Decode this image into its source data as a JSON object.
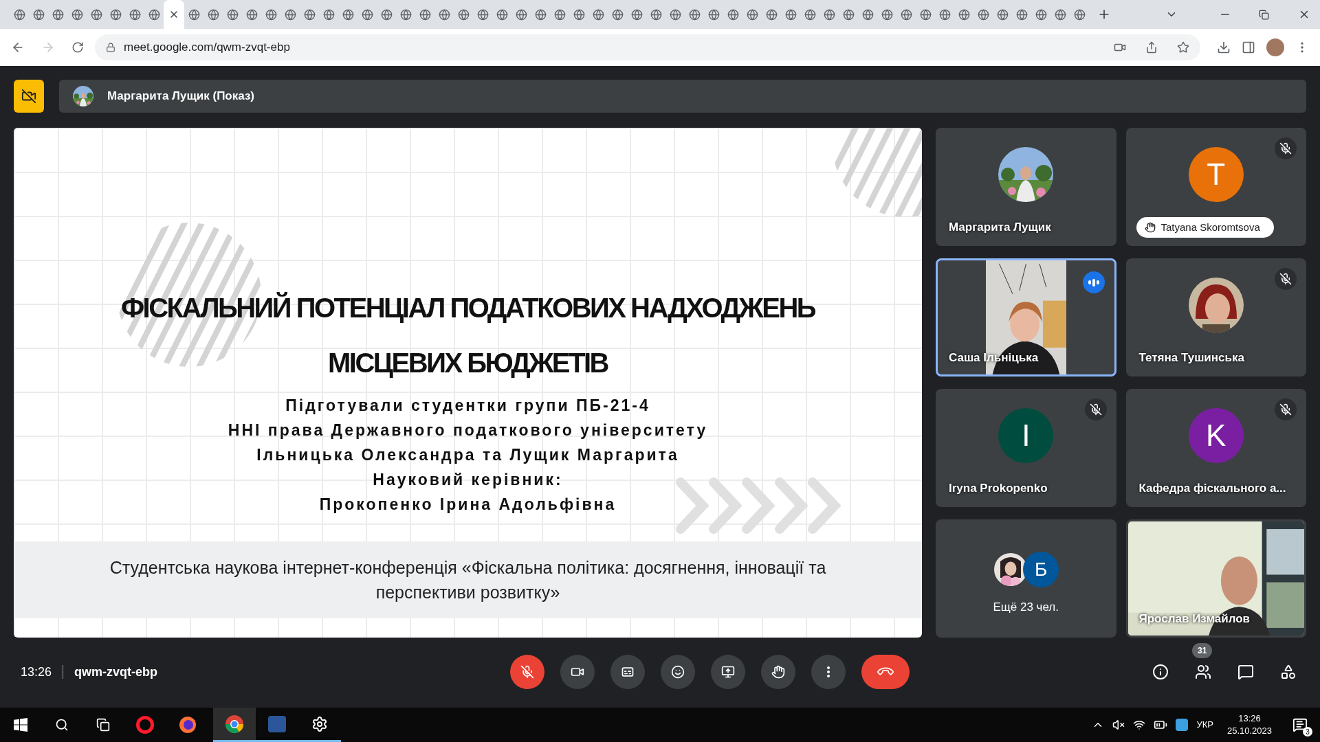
{
  "browser": {
    "tabs": [
      {
        "selected": false
      },
      {
        "selected": false
      },
      {
        "selected": false
      },
      {
        "selected": false
      },
      {
        "selected": false
      },
      {
        "selected": false
      },
      {
        "selected": false
      },
      {
        "selected": false
      },
      {
        "selected": true
      },
      {
        "selected": false
      },
      {
        "selected": false
      },
      {
        "selected": false
      },
      {
        "selected": false
      },
      {
        "selected": false
      },
      {
        "selected": false
      },
      {
        "selected": false
      },
      {
        "selected": false
      },
      {
        "selected": false
      },
      {
        "selected": false
      },
      {
        "selected": false
      },
      {
        "selected": false
      },
      {
        "selected": false
      },
      {
        "selected": false
      },
      {
        "selected": false
      },
      {
        "selected": false
      },
      {
        "selected": false
      },
      {
        "selected": false
      },
      {
        "selected": false
      },
      {
        "selected": false
      },
      {
        "selected": false
      },
      {
        "selected": false
      },
      {
        "selected": false
      },
      {
        "selected": false
      },
      {
        "selected": false
      },
      {
        "selected": false
      },
      {
        "selected": false
      },
      {
        "selected": false
      },
      {
        "selected": false
      },
      {
        "selected": false
      },
      {
        "selected": false
      },
      {
        "selected": false
      },
      {
        "selected": false
      },
      {
        "selected": false
      },
      {
        "selected": false
      },
      {
        "selected": false
      },
      {
        "selected": false
      },
      {
        "selected": false
      },
      {
        "selected": false
      },
      {
        "selected": false
      },
      {
        "selected": false
      },
      {
        "selected": false
      },
      {
        "selected": false
      },
      {
        "selected": false
      },
      {
        "selected": false
      },
      {
        "selected": false
      },
      {
        "selected": false
      }
    ],
    "url": "meet.google.com/qwm-zvqt-ebp"
  },
  "presentation": {
    "presenter": "Маргарита Лущик (Показ)",
    "slide": {
      "title_lines": [
        "ФІСКАЛЬНИЙ ПОТЕНЦІАЛ ПОДАТКОВИХ НАДХОДЖЕНЬ",
        "МІСЦЕВИХ БЮДЖЕТІВ"
      ],
      "subtitle_lines": [
        "Підготували студентки групи ПБ-21-4",
        "ННІ права Державного податкового університету",
        "Ільницька Олександра та Лущик Маргарита",
        "Науковий керівник:",
        "Прокопенко Ірина Адольфівна"
      ],
      "footer": "Студентська наукова інтернет-конференція «Фіскальна політика: досягнення, інновації та перспективи розвитку»"
    }
  },
  "participants": [
    {
      "name": "Маргарита Лущик",
      "muted": false,
      "speaking": false,
      "hand_raised": false
    },
    {
      "kind": "letter",
      "letter": "T",
      "color": "#e8710a",
      "name": "Tatyana Skoromtsova",
      "muted": true,
      "speaking": false,
      "hand_raised": true
    },
    {
      "kind": "video",
      "name": "Саша Ільніцька",
      "muted": false,
      "speaking": true,
      "hand_raised": false
    },
    {
      "name": "Тетяна Тушинська",
      "muted": true,
      "speaking": false,
      "hand_raised": false
    },
    {
      "kind": "letter",
      "letter": "I",
      "color": "#004d40",
      "name": "Iryna Prokopenko",
      "muted": true,
      "speaking": false,
      "hand_raised": false
    },
    {
      "kind": "letter",
      "letter": "K",
      "color": "#7b1fa2",
      "name": "Кафедра фіскального а...",
      "muted": true,
      "speaking": false,
      "hand_raised": false
    },
    {
      "kind": "overflow",
      "letter": "Б",
      "color": "#01579b",
      "name": "Ещё 23 чел.",
      "muted": false,
      "speaking": false,
      "hand_raised": false
    },
    {
      "kind": "video",
      "name": "Ярослав Измайлов",
      "muted": false,
      "speaking": false,
      "hand_raised": false
    }
  ],
  "meeting": {
    "time": "13:26",
    "code": "qwm-zvqt-ebp",
    "people_count": "31"
  },
  "taskbar": {
    "language": "УКР",
    "time": "13:26",
    "date": "25.10.2023",
    "notifications": "3"
  }
}
